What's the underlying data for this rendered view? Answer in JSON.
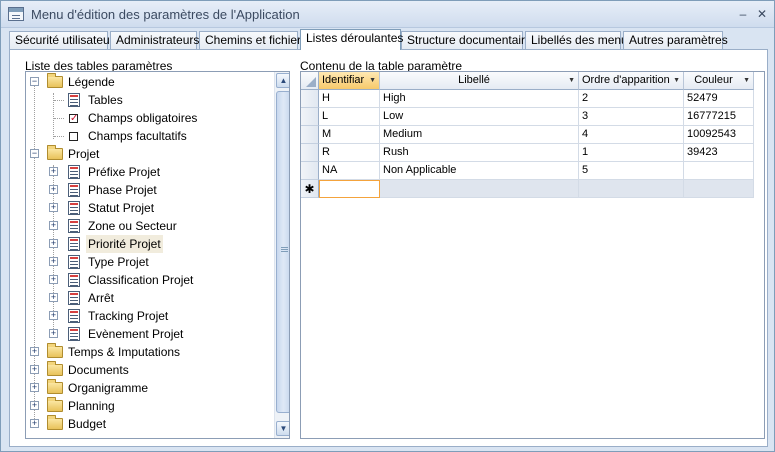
{
  "window": {
    "title": "Menu d'édition des paramètres de l'Application",
    "min_symbol": "–",
    "close_symbol": "✕"
  },
  "tabs": [
    {
      "label": "Sécurité utilisateur"
    },
    {
      "label": "Administrateurs"
    },
    {
      "label": "Chemins et fichiers"
    },
    {
      "label": "Listes déroulantes",
      "active": true
    },
    {
      "label": "Structure documentaire"
    },
    {
      "label": "Libellés des menus"
    },
    {
      "label": "Autres paramètres"
    }
  ],
  "left_panel": {
    "label": "Liste des tables paramètres",
    "tree": [
      {
        "label": "Légende",
        "type": "folder",
        "expander": "−",
        "level": 0
      },
      {
        "label": "Tables",
        "type": "table",
        "level": 1
      },
      {
        "label": "Champs obligatoires",
        "type": "checkbox",
        "checked": true,
        "level": 1
      },
      {
        "label": "Champs facultatifs",
        "type": "checkbox",
        "checked": false,
        "level": 1
      },
      {
        "label": "Projet",
        "type": "folder",
        "expander": "−",
        "level": 0
      },
      {
        "label": "Préfixe Projet",
        "type": "table",
        "expander": "+",
        "level": 1
      },
      {
        "label": "Phase Projet",
        "type": "table",
        "expander": "+",
        "level": 1
      },
      {
        "label": "Statut Projet",
        "type": "table",
        "expander": "+",
        "level": 1
      },
      {
        "label": "Zone ou Secteur",
        "type": "table",
        "expander": "+",
        "level": 1
      },
      {
        "label": "Priorité Projet",
        "type": "table",
        "expander": "+",
        "level": 1,
        "selected": true
      },
      {
        "label": "Type Projet",
        "type": "table",
        "expander": "+",
        "level": 1
      },
      {
        "label": "Classification Projet",
        "type": "table",
        "expander": "+",
        "level": 1
      },
      {
        "label": "Arrêt",
        "type": "table",
        "expander": "+",
        "level": 1
      },
      {
        "label": "Tracking Projet",
        "type": "table",
        "expander": "+",
        "level": 1
      },
      {
        "label": "Evènement Projet",
        "type": "table",
        "expander": "+",
        "level": 1
      },
      {
        "label": "Temps & Imputations",
        "type": "folder",
        "expander": "+",
        "level": 0
      },
      {
        "label": "Documents",
        "type": "folder",
        "expander": "+",
        "level": 0
      },
      {
        "label": "Organigramme",
        "type": "folder",
        "expander": "+",
        "level": 0
      },
      {
        "label": "Planning",
        "type": "folder",
        "expander": "+",
        "level": 0
      },
      {
        "label": "Budget",
        "type": "folder",
        "expander": "+",
        "level": 0
      }
    ]
  },
  "right_panel": {
    "label": "Contenu de la table paramètre",
    "columns": [
      {
        "label": "Identifiar"
      },
      {
        "label": "Libellé"
      },
      {
        "label": "Ordre d'apparition"
      },
      {
        "label": "Couleur"
      }
    ],
    "rows": [
      [
        "H",
        "High",
        "2",
        "52479"
      ],
      [
        "L",
        "Low",
        "3",
        "16777215"
      ],
      [
        "M",
        "Medium",
        "4",
        "10092543"
      ],
      [
        "R",
        "Rush",
        "1",
        "39423"
      ],
      [
        "NA",
        "Non Applicable",
        "5",
        ""
      ]
    ],
    "new_row_marker": "✱"
  }
}
